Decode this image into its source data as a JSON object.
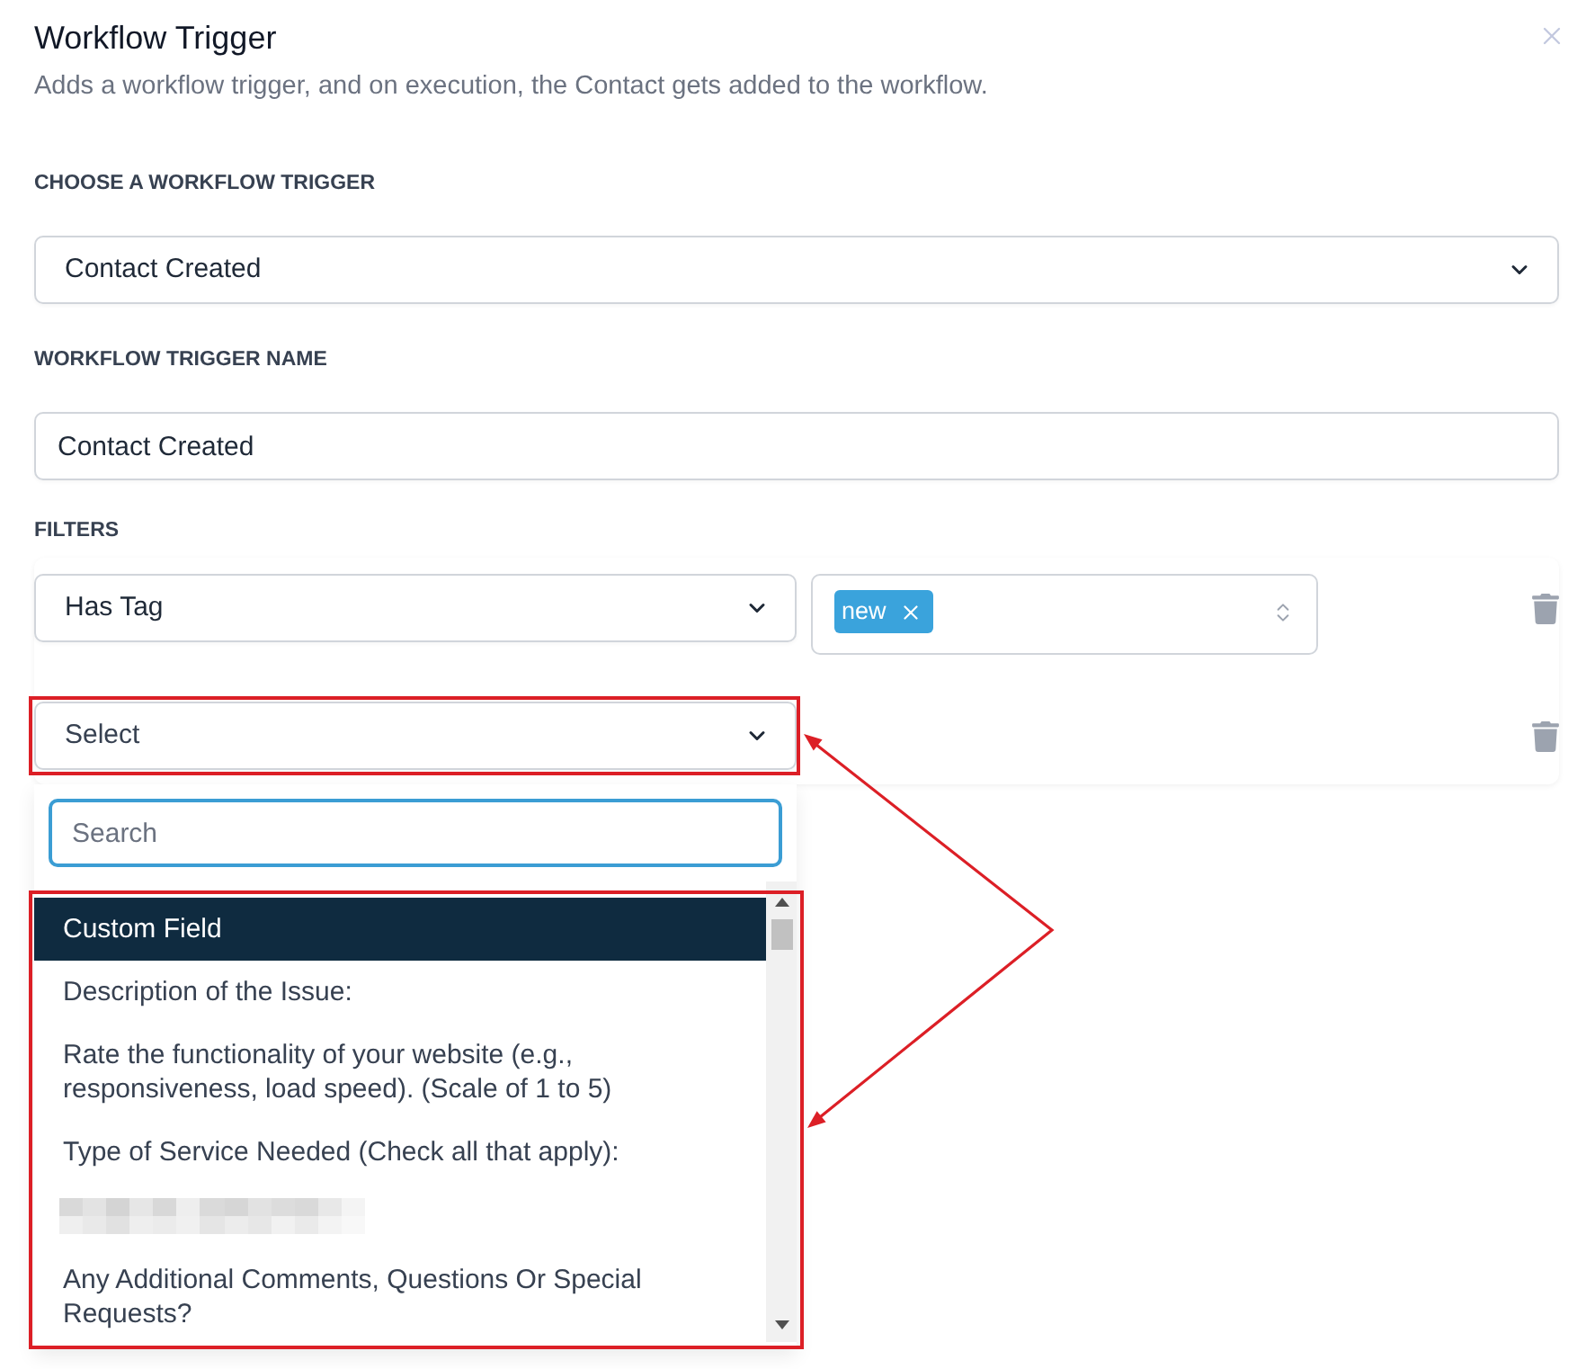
{
  "dialog": {
    "title": "Workflow Trigger",
    "subtitle": "Adds a workflow trigger, and on execution, the Contact gets added to the workflow."
  },
  "trigger_select": {
    "label": "CHOOSE A WORKFLOW TRIGGER",
    "value": "Contact Created"
  },
  "trigger_name": {
    "label": "WORKFLOW TRIGGER NAME",
    "value": "Contact Created"
  },
  "filters": {
    "label": "FILTERS",
    "rows": [
      {
        "field": {
          "value": "Has Tag"
        },
        "tags": [
          "new"
        ]
      },
      {
        "field": {
          "placeholder": "Select"
        },
        "dropdown": {
          "search": {
            "placeholder": "Search"
          },
          "options": [
            {
              "kind": "option",
              "label": "Custom Field",
              "selected": true
            },
            {
              "kind": "option",
              "label": "Description of the Issue:",
              "selected": false
            },
            {
              "kind": "option",
              "label": "Rate the functionality of your website (e.g., responsiveness, load speed). (Scale of 1 to 5)",
              "selected": false
            },
            {
              "kind": "option",
              "label": "Type of Service Needed (Check all that apply):",
              "selected": false
            },
            {
              "kind": "redacted",
              "selected": false
            },
            {
              "kind": "option",
              "label": "Any Additional Comments, Questions Or Special Requests?",
              "selected": false
            }
          ]
        }
      }
    ]
  }
}
